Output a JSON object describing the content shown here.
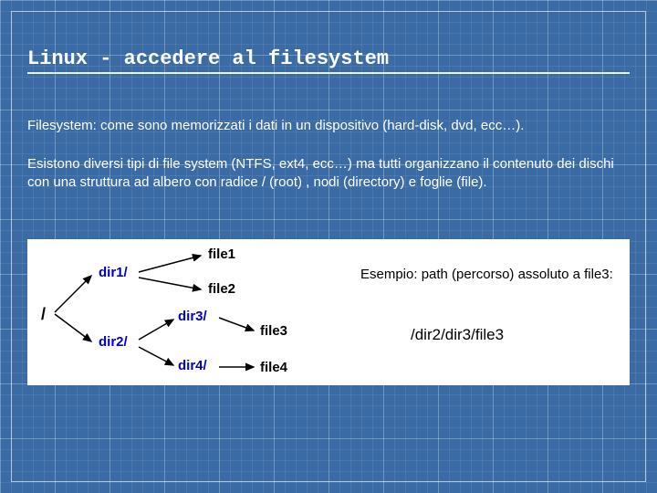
{
  "title": "Linux - accedere al filesystem",
  "para1": "Filesystem: come sono memorizzati i dati in un dispositivo (hard-disk, dvd, ecc…).",
  "para2": "Esistono diversi tipi di file system (NTFS, ext4, ecc…) ma tutti organizzano il contenuto dei dischi con una struttura ad albero con radice / (root) , nodi (directory) e foglie (file).",
  "diagram": {
    "root": "/",
    "dir1": "dir1/",
    "dir2": "dir2/",
    "dir3": "dir3/",
    "dir4": "dir4/",
    "file1": "file1",
    "file2": "file2",
    "file3": "file3",
    "file4": "file4",
    "caption": "Esempio: path (percorso) assoluto a file3:",
    "path": "/dir2/dir3/file3"
  }
}
